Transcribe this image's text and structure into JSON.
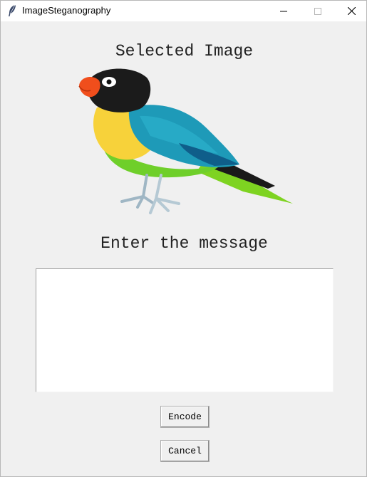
{
  "window": {
    "title": "ImageSteganography",
    "app_icon": "feather-icon",
    "controls": {
      "minimize_icon": "minimize-icon",
      "maximize_icon": "maximize-icon",
      "close_icon": "close-icon"
    }
  },
  "main": {
    "selected_image_heading": "Selected Image",
    "image_subject": "parrot-image",
    "message_heading": "Enter the message",
    "message_value": "",
    "encode_label": "Encode",
    "cancel_label": "Cancel"
  },
  "colors": {
    "window_bg": "#f0f0f0",
    "titlebar_bg": "#ffffff",
    "textbox_bg": "#ffffff"
  }
}
